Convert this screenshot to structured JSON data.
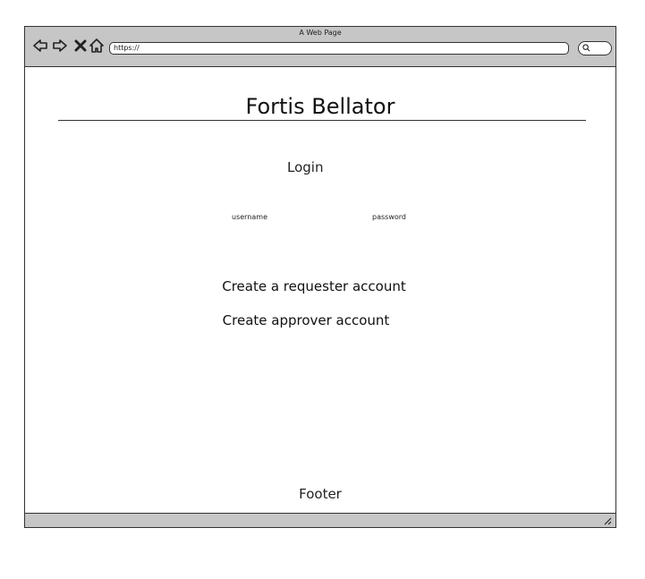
{
  "window": {
    "title": "A Web Page"
  },
  "toolbar": {
    "url": "https://",
    "icons": [
      "back-arrow-icon",
      "forward-arrow-icon",
      "close-icon",
      "home-icon",
      "search-icon"
    ]
  },
  "page": {
    "title": "Fortis Bellator",
    "login_heading": "Login",
    "username_label": "username",
    "password_label": "password",
    "requester_link": "Create a requester account",
    "approver_link": "Create approver account",
    "footer": "Footer"
  }
}
